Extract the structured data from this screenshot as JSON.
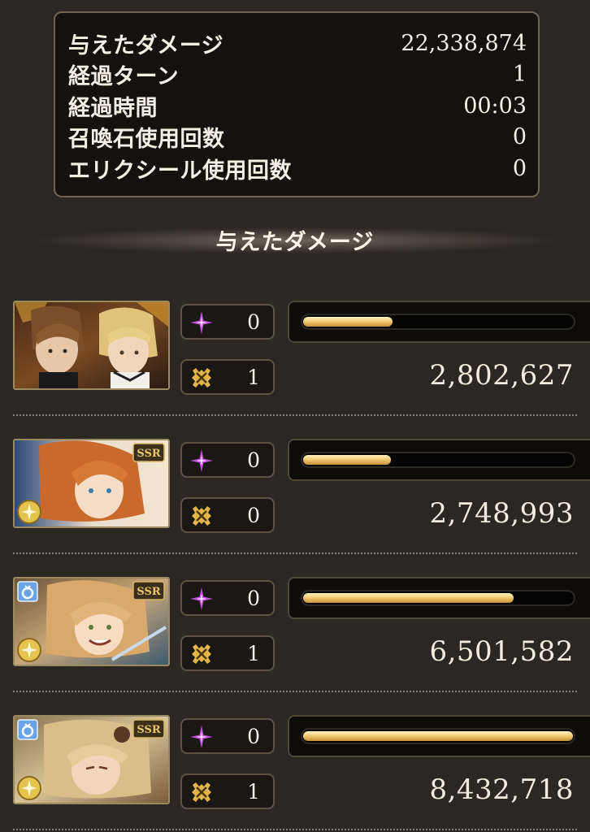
{
  "stats": [
    {
      "label": "与えたダメージ",
      "value": "22,338,874"
    },
    {
      "label": "経過ターン",
      "value": "1"
    },
    {
      "label": "経過時間",
      "value": "00:03"
    },
    {
      "label": "召喚石使用回数",
      "value": "0"
    },
    {
      "label": "エリクシール使用回数",
      "value": "0"
    }
  ],
  "section": {
    "title": "与えたダメージ"
  },
  "characters": [
    {
      "skill_count": "0",
      "ougi_count": "1",
      "damage": "2,802,627",
      "damage_share": 0.33
    },
    {
      "skill_count": "0",
      "ougi_count": "0",
      "damage": "2,748,993",
      "damage_share": 0.325
    },
    {
      "skill_count": "0",
      "ougi_count": "1",
      "damage": "6,501,582",
      "damage_share": 0.78
    },
    {
      "skill_count": "0",
      "ougi_count": "1",
      "damage": "8,432,718",
      "damage_share": 1.0
    }
  ],
  "icons": {
    "skill": "purple-sparkle-icon",
    "ougi": "gold-crossed-swords-icon",
    "element": "light-element-icon",
    "rarity": "ssr-badge",
    "friend_summon": "ring-icon"
  },
  "colors": {
    "bar_fill": "#f4cc74",
    "skill_icon": "#c04fd8",
    "ougi_icon": "#e2b64a"
  }
}
